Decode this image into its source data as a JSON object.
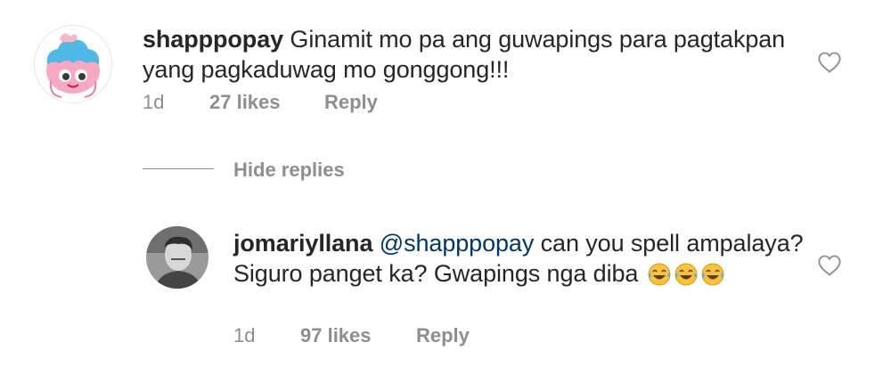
{
  "comment": {
    "username": "shapppopay",
    "text": " Ginamit mo pa ang guwapings para pagtakpan yang pagkaduwag mo gonggong!!!",
    "time": "1d",
    "likes": "27 likes",
    "reply_label": "Reply",
    "avatar_icon": "cupcake-character-icon",
    "like_icon": "heart-outline-icon"
  },
  "hide_replies_label": "Hide replies",
  "reply": {
    "username": "jomariyllana",
    "mention": "@shapppopay",
    "text_line1": " can you spell ampalaya?",
    "text_line2": "Siguro panget ka? Gwapings nga diba",
    "emoji": [
      "laughing-tears-emoji",
      "laughing-tears-emoji",
      "laughing-tears-emoji"
    ],
    "time": "1d",
    "likes": "97 likes",
    "reply_label": "Reply",
    "avatar_icon": "user-photo-avatar",
    "like_icon": "heart-outline-icon"
  },
  "colors": {
    "text": "#262626",
    "secondary": "#8e8e8e",
    "mention": "#00376b",
    "background": "#ffffff"
  }
}
